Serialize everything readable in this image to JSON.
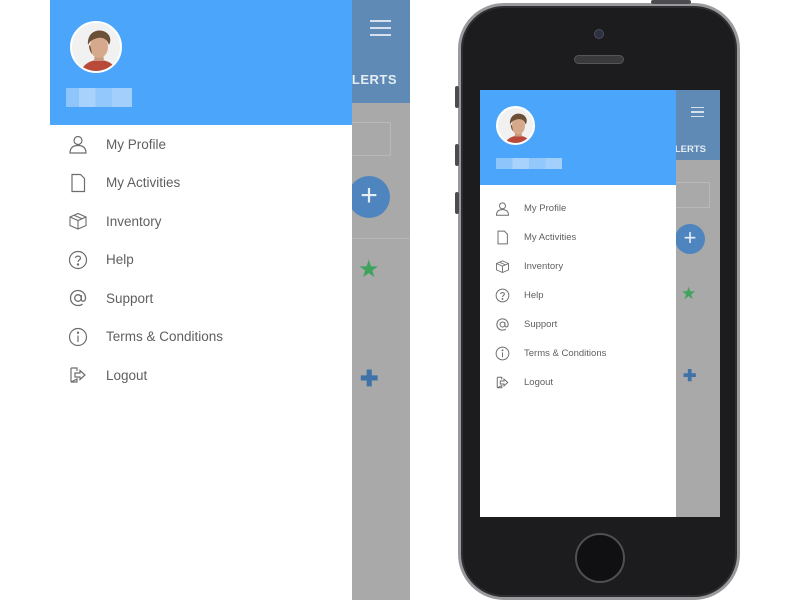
{
  "app": {
    "background_tab_label": "ALERTS",
    "accent_color": "#4ba6fb"
  },
  "menu": {
    "items": [
      {
        "label": "My Profile",
        "icon": "person-icon"
      },
      {
        "label": "My Activities",
        "icon": "document-icon"
      },
      {
        "label": "Inventory",
        "icon": "box-icon"
      },
      {
        "label": "Help",
        "icon": "question-icon"
      },
      {
        "label": "Support",
        "icon": "at-icon"
      },
      {
        "label": "Terms & Conditions",
        "icon": "info-icon"
      },
      {
        "label": "Logout",
        "icon": "logout-icon"
      }
    ]
  },
  "background": {
    "fab_symbol": "+",
    "star_symbol": "★",
    "plus_symbol": "✚"
  }
}
